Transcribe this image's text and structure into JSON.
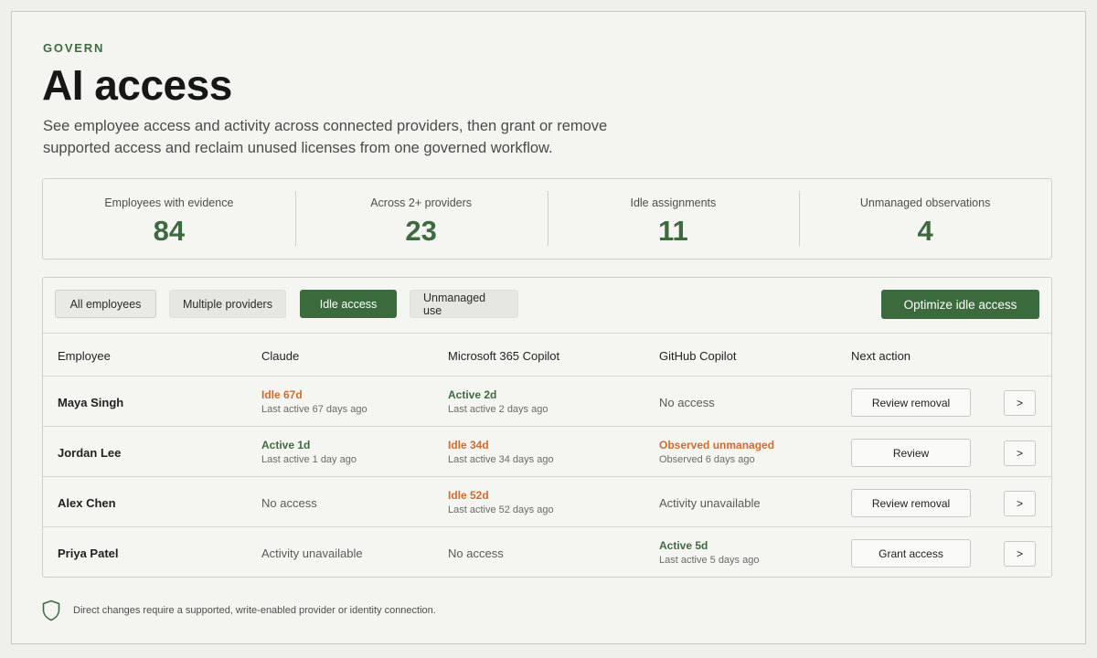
{
  "header": {
    "eyebrow": "GOVERN",
    "title": "AI access",
    "subtitle": "See employee access and activity across connected providers, then grant or remove supported access and reclaim unused licenses from one governed workflow."
  },
  "stats": [
    {
      "label": "Employees with evidence",
      "value": "84"
    },
    {
      "label": "Across 2+ providers",
      "value": "23"
    },
    {
      "label": "Idle assignments",
      "value": "11"
    },
    {
      "label": "Unmanaged observations",
      "value": "4"
    }
  ],
  "filters": [
    {
      "label": "All employees",
      "state": "outlined"
    },
    {
      "label": "Multiple providers",
      "state": "default"
    },
    {
      "label": "Idle access",
      "state": "active"
    },
    {
      "label": "Unmanaged use",
      "state": "default"
    }
  ],
  "primary_action": "Optimize idle access",
  "columns": [
    "Employee",
    "Claude",
    "Microsoft 365 Copilot",
    "GitHub Copilot",
    "Next action"
  ],
  "rows": [
    {
      "employee": "Maya Singh",
      "claude": {
        "status": "Idle 67d",
        "detail": "Last active 67 days ago",
        "tone": "idle"
      },
      "m365": {
        "status": "Active 2d",
        "detail": "Last active 2 days ago",
        "tone": "active"
      },
      "github": {
        "status": "No access",
        "detail": "",
        "tone": "plain"
      },
      "action": "Review removal",
      "more": ">"
    },
    {
      "employee": "Jordan Lee",
      "claude": {
        "status": "Active 1d",
        "detail": "Last active 1 day ago",
        "tone": "active"
      },
      "m365": {
        "status": "Idle 34d",
        "detail": "Last active 34 days ago",
        "tone": "idle"
      },
      "github": {
        "status": "Observed unmanaged",
        "detail": "Observed 6 days ago",
        "tone": "idle"
      },
      "action": "Review",
      "more": ">"
    },
    {
      "employee": "Alex Chen",
      "claude": {
        "status": "No access",
        "detail": "",
        "tone": "plain"
      },
      "m365": {
        "status": "Idle 52d",
        "detail": "Last active 52 days ago",
        "tone": "idle"
      },
      "github": {
        "status": "Activity unavailable",
        "detail": "",
        "tone": "plain"
      },
      "action": "Review removal",
      "more": ">"
    },
    {
      "employee": "Priya Patel",
      "claude": {
        "status": "Activity unavailable",
        "detail": "",
        "tone": "plain"
      },
      "m365": {
        "status": "No access",
        "detail": "",
        "tone": "plain"
      },
      "github": {
        "status": "Active 5d",
        "detail": "Last active 5 days ago",
        "tone": "active"
      },
      "action": "Grant access",
      "more": ">"
    }
  ],
  "footnote": {
    "icon": "shield-icon",
    "text": "Direct changes require a supported, write-enabled provider or identity connection."
  },
  "colors": {
    "accent": "#3b6b3d",
    "idle": "#d26a2b",
    "background": "#efefec"
  }
}
